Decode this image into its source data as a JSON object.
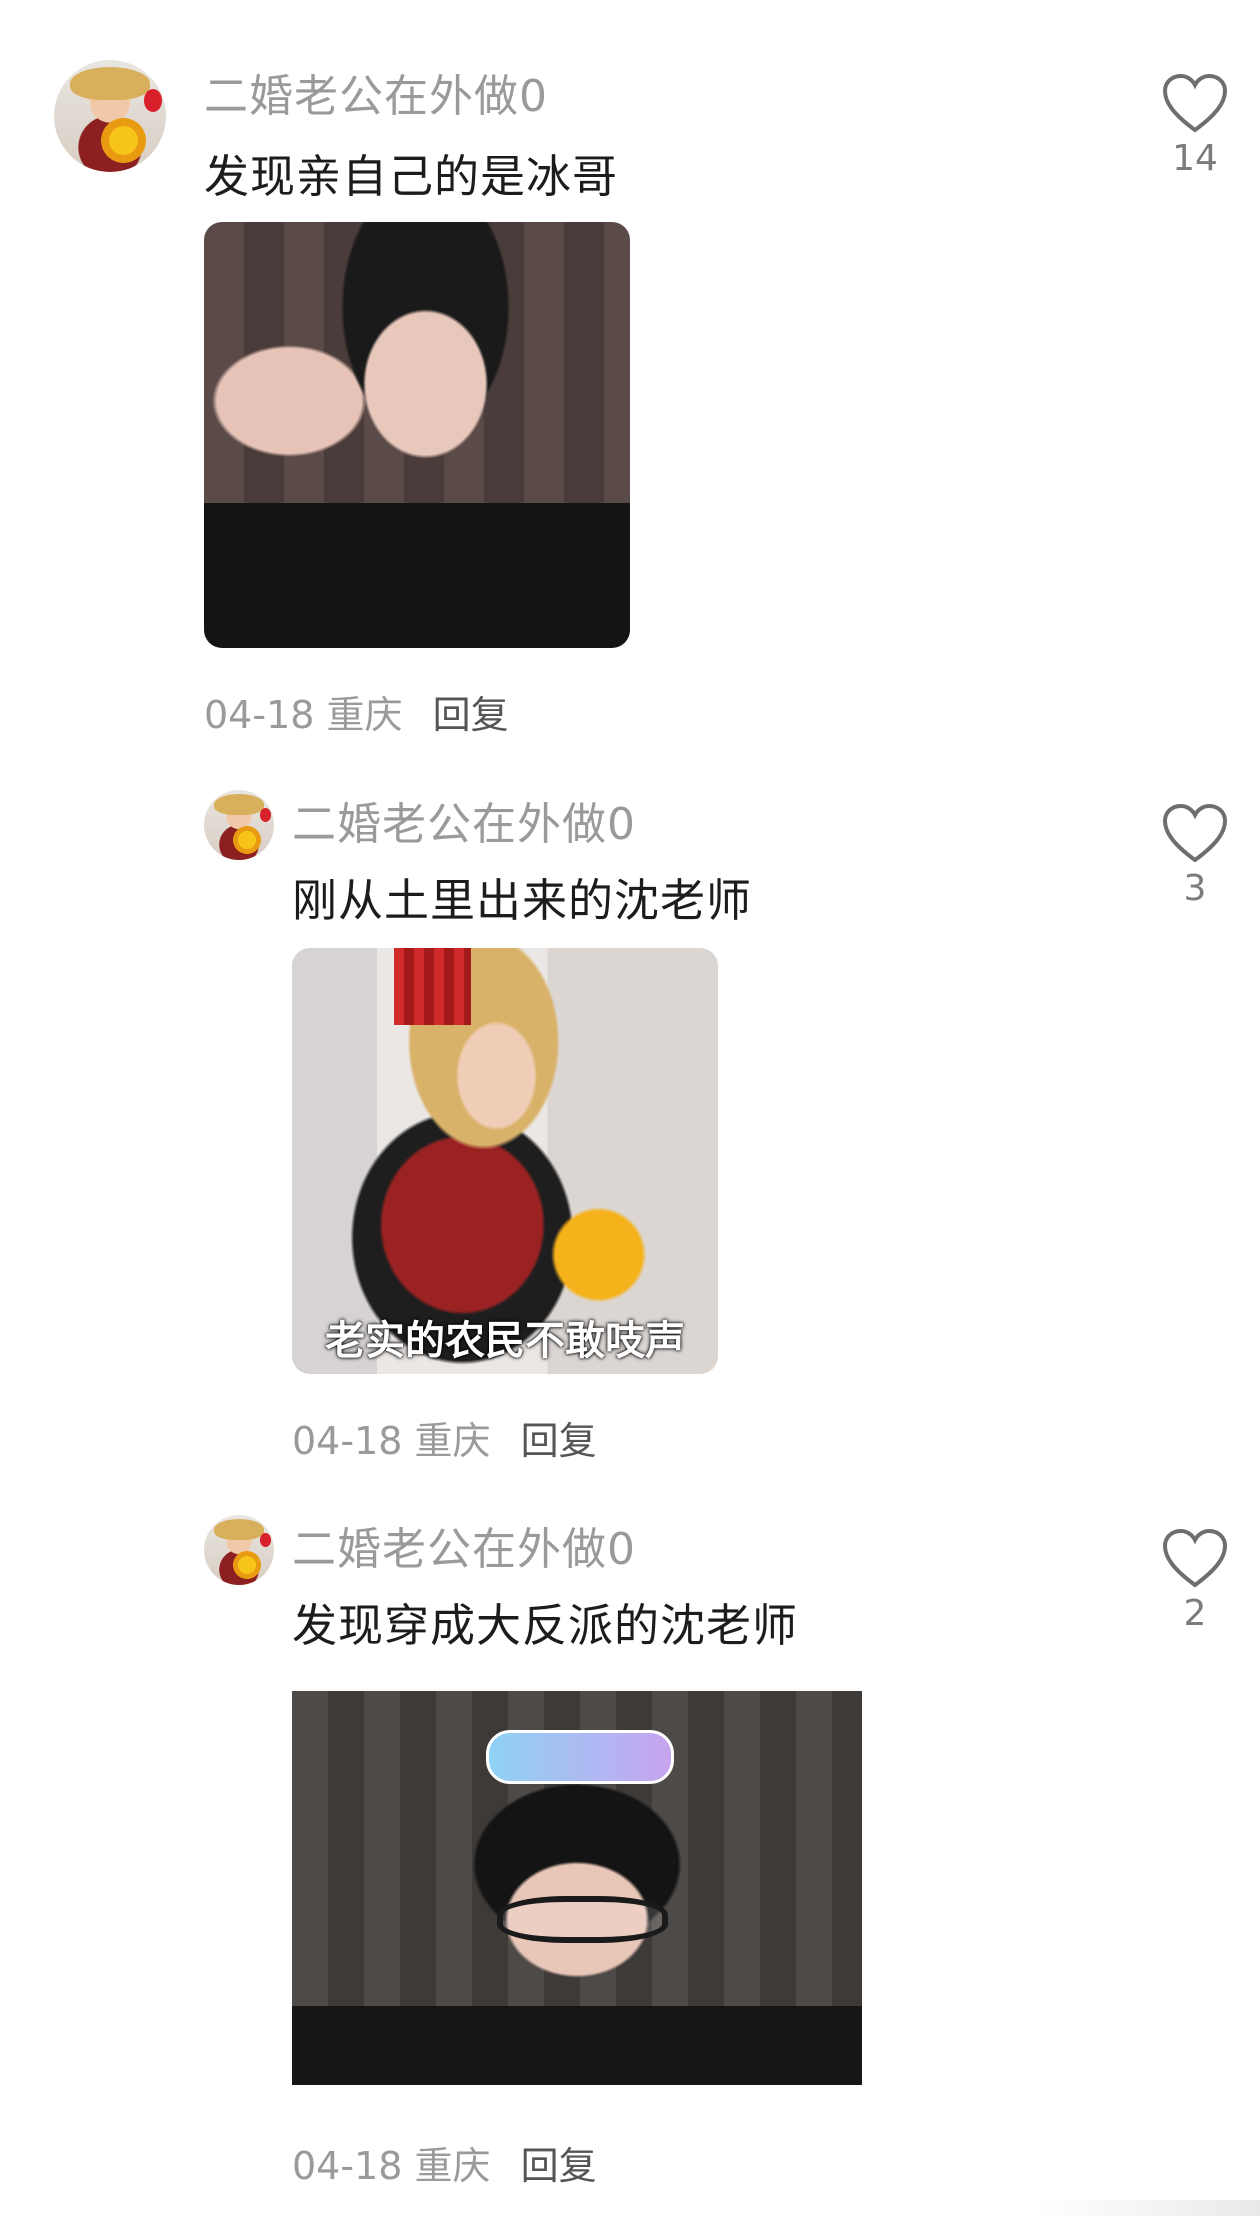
{
  "comments": [
    {
      "username": "二婚老公在外做0",
      "text": "发现亲自己的是冰哥",
      "date": "04-18",
      "location": "重庆",
      "reply_label": "回复",
      "likes": "14"
    },
    {
      "username": "二婚老公在外做0",
      "text": "刚从土里出来的沈老师",
      "image_caption": "老实的农民不敢吱声",
      "date": "04-18",
      "location": "重庆",
      "reply_label": "回复",
      "likes": "3"
    },
    {
      "username": "二婚老公在外做0",
      "text": "发现穿成大反派的沈老师",
      "date": "04-18",
      "location": "重庆",
      "reply_label": "回复",
      "likes": "2"
    }
  ]
}
